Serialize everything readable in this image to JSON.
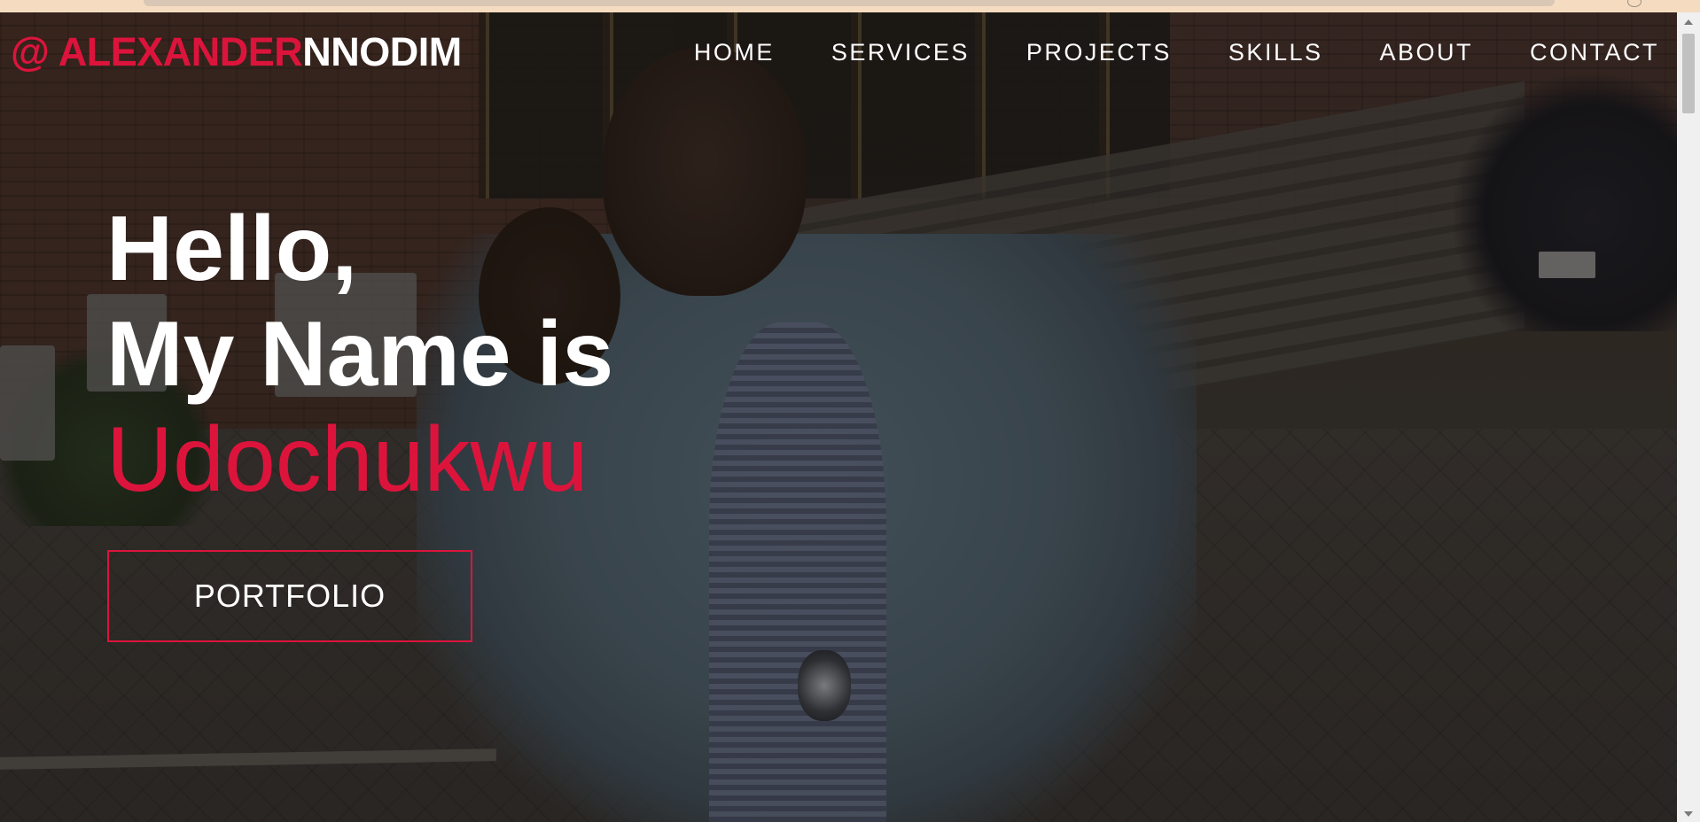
{
  "brand": {
    "prefix": "@ ALEXANDER",
    "suffix": "NNODIM"
  },
  "nav": {
    "items": [
      {
        "label": "HOME"
      },
      {
        "label": "SERVICES"
      },
      {
        "label": "PROJECTS"
      },
      {
        "label": "SKILLS"
      },
      {
        "label": "ABOUT"
      },
      {
        "label": "CONTACT"
      }
    ]
  },
  "hero": {
    "line1": "Hello,",
    "line2": "My Name is",
    "name": "Udochukwu",
    "button_label": "PORTFOLIO"
  },
  "colors": {
    "accent": "#dc143c",
    "text": "#ffffff",
    "top_strip": "#f5dcc0"
  }
}
